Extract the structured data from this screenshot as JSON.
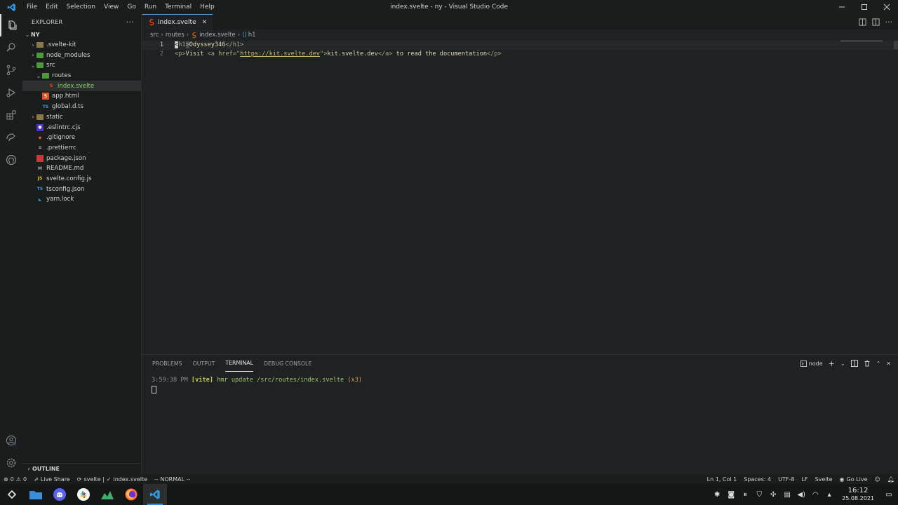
{
  "window": {
    "title": "index.svelte - ny - Visual Studio Code",
    "menu": [
      "File",
      "Edit",
      "Selection",
      "View",
      "Go",
      "Run",
      "Terminal",
      "Help"
    ]
  },
  "activity_bar": {
    "items": [
      "files-icon",
      "search-icon",
      "source-control-icon",
      "run-debug-icon",
      "extensions-icon",
      "remote-explorer-icon",
      "github-icon"
    ],
    "bottom": [
      "accounts-icon",
      "settings-gear-icon"
    ]
  },
  "sidebar": {
    "title": "EXPLORER",
    "root": "NY",
    "tree": [
      {
        "label": ".svelte-kit",
        "depth": 1,
        "kind": "folder",
        "chevron": "›"
      },
      {
        "label": "node_modules",
        "depth": 1,
        "kind": "folder-green",
        "chevron": "›"
      },
      {
        "label": "src",
        "depth": 1,
        "kind": "folder-green",
        "chevron": "⌄"
      },
      {
        "label": "routes",
        "depth": 2,
        "kind": "folder-green",
        "chevron": "⌄"
      },
      {
        "label": "index.svelte",
        "depth": 3,
        "kind": "svelte",
        "chevron": "",
        "selected": true
      },
      {
        "label": "app.html",
        "depth": 2,
        "kind": "html",
        "chevron": ""
      },
      {
        "label": "global.d.ts",
        "depth": 2,
        "kind": "ts",
        "chevron": ""
      },
      {
        "label": "static",
        "depth": 1,
        "kind": "folder",
        "chevron": "›"
      },
      {
        "label": ".eslintrc.cjs",
        "depth": 1,
        "kind": "eslint",
        "chevron": ""
      },
      {
        "label": ".gitignore",
        "depth": 1,
        "kind": "git",
        "chevron": ""
      },
      {
        "label": ".prettierrc",
        "depth": 1,
        "kind": "prettier",
        "chevron": ""
      },
      {
        "label": "package.json",
        "depth": 1,
        "kind": "npm",
        "chevron": ""
      },
      {
        "label": "README.md",
        "depth": 1,
        "kind": "md",
        "chevron": ""
      },
      {
        "label": "svelte.config.js",
        "depth": 1,
        "kind": "js",
        "chevron": ""
      },
      {
        "label": "tsconfig.json",
        "depth": 1,
        "kind": "tsconfig",
        "chevron": ""
      },
      {
        "label": "yarn.lock",
        "depth": 1,
        "kind": "yarn",
        "chevron": ""
      }
    ],
    "outline": "OUTLINE"
  },
  "editor": {
    "tab": "index.svelte",
    "breadcrumb": [
      "src",
      "routes",
      "index.svelte",
      "h1"
    ],
    "line_numbers": [
      "1",
      "2"
    ],
    "line1": {
      "open_lt": "<",
      "open_name": "h1",
      "open_gt": ">",
      "text": "Odyssey346",
      "close": "</h1>"
    },
    "line2": {
      "p_open": "<p>",
      "visit": "Visit ",
      "a_open": "<a ",
      "href_attr": "href=",
      "quote": "\"",
      "url": "https://kit.svelte.dev",
      "quote2": "\"",
      "gt": ">",
      "link_text": "kit.svelte.dev",
      "a_close": "</a>",
      "rest": " to read the documentation",
      "p_close": "</p>"
    }
  },
  "panel": {
    "tabs": [
      "PROBLEMS",
      "OUTPUT",
      "TERMINAL",
      "DEBUG CONSOLE"
    ],
    "active_tab": "TERMINAL",
    "terminal_name": "node",
    "output": {
      "time": "3:59:38 PM ",
      "tag": "[vite]",
      "msg": " hmr update /src/routes/index.svelte ",
      "count": "(x3)"
    }
  },
  "status_bar": {
    "errors": "0",
    "warnings": "0",
    "live_share": "Live Share",
    "svelte": "svelte |",
    "check_file": "index.svelte",
    "mode": "-- NORMAL --",
    "position": "Ln 1, Col 1",
    "spaces": "Spaces: 4",
    "encoding": "UTF-8",
    "eol": "LF",
    "language": "Svelte",
    "go_live": "Go Live"
  },
  "taskbar": {
    "apps": [
      "launcher-icon",
      "file-manager-icon",
      "discord-icon",
      "slack-icon",
      "system-monitor-icon",
      "firefox-icon",
      "vscode-icon"
    ],
    "time": "16:12",
    "date": "25.08.2021"
  },
  "colors": {
    "accent": "#61a0e8",
    "svelte": "#ff3e00",
    "folder_green": "#4e9a3a"
  }
}
